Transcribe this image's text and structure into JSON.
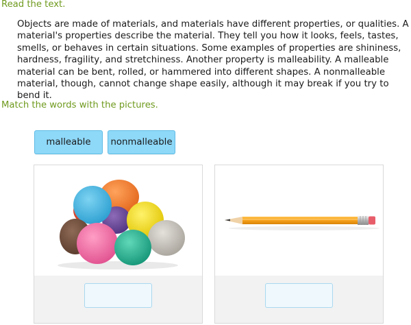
{
  "instructions": {
    "read": "Read the text.",
    "match": "Match the words with the pictures."
  },
  "passage": "Objects are made of materials, and materials have different properties, or qualities. A material's properties describe the material. They tell you how it looks, feels, tastes, smells, or behaves in certain situations. Some examples of properties are shininess, hardness, fragility, and stretchiness. Another property is malleability. A malleable material can be bent, rolled, or hammered into different shapes. A nonmalleable material, though, cannot change shape easily, although it may break if you try to bend it.",
  "word_tiles": [
    {
      "label": "malleable"
    },
    {
      "label": "nonmalleable"
    }
  ],
  "picture_cards": [
    {
      "image_icon": "play-dough-balls-icon",
      "answer": ""
    },
    {
      "image_icon": "pencil-icon",
      "answer": ""
    }
  ],
  "colors": {
    "instruction_text": "#6f9a1e",
    "tile_fill": "#8ed8f8",
    "tile_border": "#5dbbe5",
    "drop_target_fill": "#eef8fd",
    "card_footer": "#f2f2f2"
  }
}
